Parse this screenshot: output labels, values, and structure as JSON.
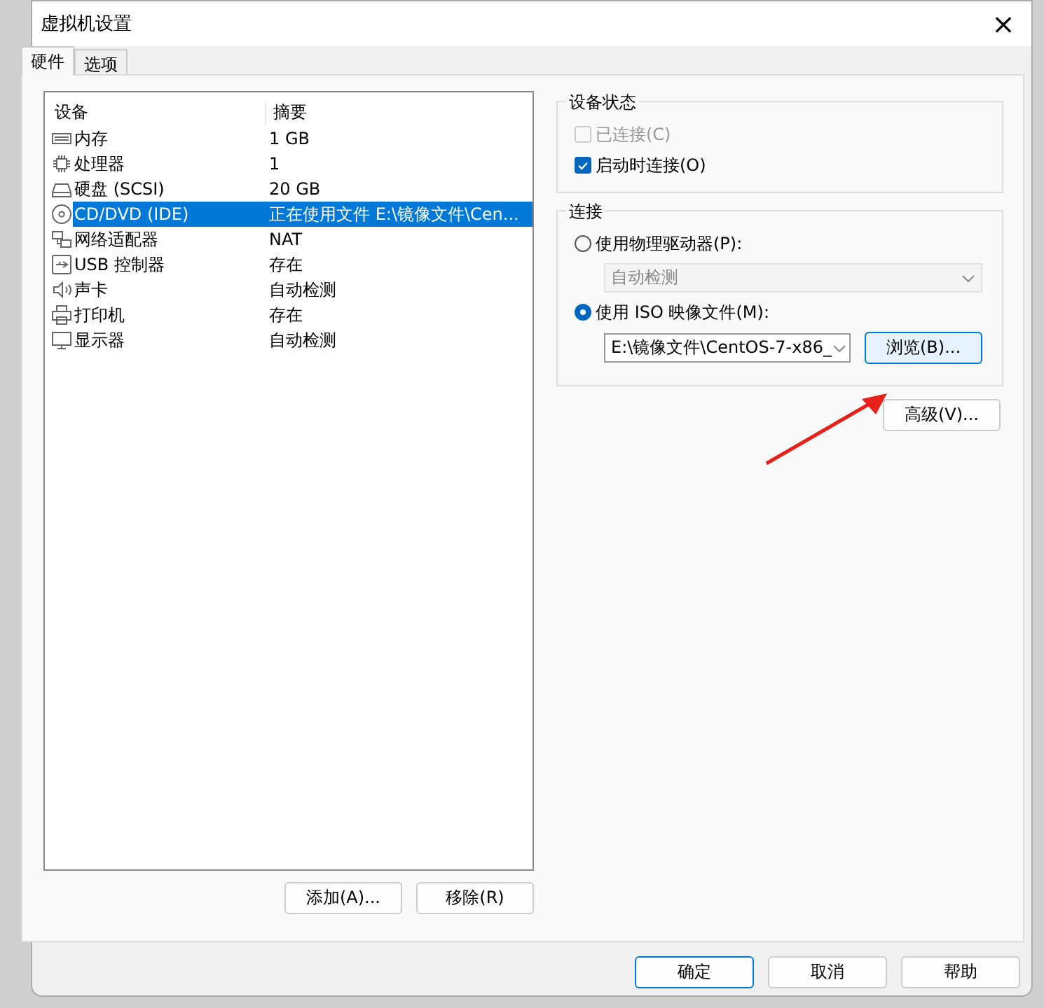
{
  "window": {
    "title": "虚拟机设置",
    "close": "×"
  },
  "tabs": [
    {
      "label": "硬件",
      "selected": true
    },
    {
      "label": "选项",
      "selected": false
    }
  ],
  "devices": {
    "columns": [
      "设备",
      "摘要"
    ],
    "rows": [
      {
        "kind": "memory",
        "name": "内存",
        "summary": "1 GB",
        "selected": false
      },
      {
        "kind": "cpu",
        "name": "处理器",
        "summary": "1",
        "selected": false
      },
      {
        "kind": "disk",
        "name": "硬盘 (SCSI)",
        "summary": "20 GB",
        "selected": false
      },
      {
        "kind": "cd",
        "name": "CD/DVD (IDE)",
        "summary": "正在使用文件 E:\\镜像文件\\Cen...",
        "selected": true
      },
      {
        "kind": "network",
        "name": "网络适配器",
        "summary": "NAT",
        "selected": false
      },
      {
        "kind": "usb",
        "name": "USB 控制器",
        "summary": "存在",
        "selected": false
      },
      {
        "kind": "sound",
        "name": "声卡",
        "summary": "自动检测",
        "selected": false
      },
      {
        "kind": "printer",
        "name": "打印机",
        "summary": "存在",
        "selected": false
      },
      {
        "kind": "display",
        "name": "显示器",
        "summary": "自动检测",
        "selected": false
      }
    ]
  },
  "list_buttons": [
    "添加(A)...",
    "移除(R)"
  ],
  "device_status": {
    "title": "设备状态",
    "options": [
      {
        "label": "已连接(C)",
        "checked": false,
        "disabled": true
      },
      {
        "label": "启动时连接(O)",
        "checked": true,
        "disabled": false
      }
    ]
  },
  "connection": {
    "title": "连接",
    "options": [
      {
        "label": "使用物理驱动器(P):",
        "selected": false,
        "dropdown": {
          "value": "自动检测",
          "disabled": true
        }
      },
      {
        "label": "使用 ISO 映像文件(M):",
        "selected": true,
        "dropdown": {
          "value": "E:\\镜像文件\\CentOS-7-x86_",
          "disabled": false
        },
        "button": "浏览(B)..."
      }
    ]
  },
  "advanced_button": "高级(V)...",
  "dialog_buttons": [
    {
      "label": "确定",
      "default": true
    },
    {
      "label": "取消",
      "default": false
    },
    {
      "label": "帮助",
      "default": false
    }
  ]
}
